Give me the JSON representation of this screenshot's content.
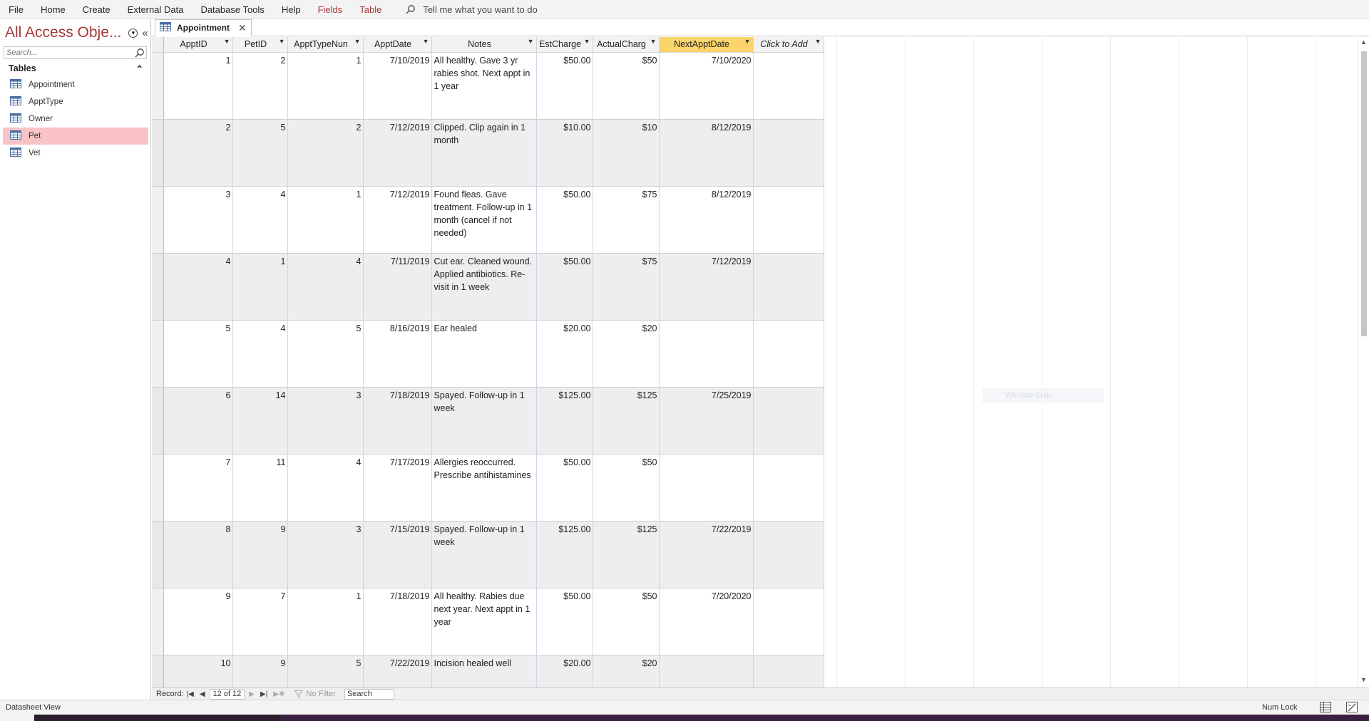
{
  "ribbon": {
    "menus": [
      "File",
      "Home",
      "Create",
      "External Data",
      "Database Tools",
      "Help"
    ],
    "context_menus": [
      "Fields",
      "Table"
    ],
    "tell_me": "Tell me what you want to do"
  },
  "nav": {
    "title": "All Access Obje...",
    "search_placeholder": "Search...",
    "group_label": "Tables",
    "items": [
      "Appointment",
      "ApptType",
      "Owner",
      "Pet",
      "Vet"
    ],
    "selected": "Pet"
  },
  "tab": {
    "label": "Appointment"
  },
  "grid": {
    "columns": [
      "ApptID",
      "PetID",
      "ApptTypeNun",
      "ApptDate",
      "Notes",
      "EstCharge",
      "ActualCharg",
      "NextApptDate",
      "Click to Add"
    ],
    "selected_column": "NextApptDate",
    "rows": [
      [
        "1",
        "2",
        "1",
        "7/10/2019",
        "All healthy. Gave 3 yr rabies shot. Next appt in 1 year",
        "$50.00",
        "$50",
        "7/10/2020"
      ],
      [
        "2",
        "5",
        "2",
        "7/12/2019",
        "Clipped. Clip again in 1 month",
        "$10.00",
        "$10",
        "8/12/2019"
      ],
      [
        "3",
        "4",
        "1",
        "7/12/2019",
        "Found fleas. Gave treatment. Follow-up in 1 month (cancel if not needed)",
        "$50.00",
        "$75",
        "8/12/2019"
      ],
      [
        "4",
        "1",
        "4",
        "7/11/2019",
        "Cut ear. Cleaned wound. Applied antibiotics. Re-visit in 1 week",
        "$50.00",
        "$75",
        "7/12/2019"
      ],
      [
        "5",
        "4",
        "5",
        "8/16/2019",
        "Ear healed",
        "$20.00",
        "$20",
        ""
      ],
      [
        "6",
        "14",
        "3",
        "7/18/2019",
        "Spayed. Follow-up in 1 week",
        "$125.00",
        "$125",
        "7/25/2019"
      ],
      [
        "7",
        "11",
        "4",
        "7/17/2019",
        "Allergies reoccurred. Prescribe antihistamines",
        "$50.00",
        "$50",
        ""
      ],
      [
        "8",
        "9",
        "3",
        "7/15/2019",
        "Spayed. Follow-up in 1 week",
        "$125.00",
        "$125",
        "7/22/2019"
      ],
      [
        "9",
        "7",
        "1",
        "7/18/2019",
        "All healthy. Rabies due next year. Next appt in 1 year",
        "$50.00",
        "$50",
        "7/20/2020"
      ],
      [
        "10",
        "9",
        "5",
        "7/22/2019",
        "Incision healed well",
        "$20.00",
        "$20",
        ""
      ]
    ]
  },
  "record_nav": {
    "label": "Record:",
    "position": "12 of 12",
    "filter": "No Filter",
    "search": "Search"
  },
  "status": {
    "view": "Datasheet View",
    "numlock": "Num Lock"
  },
  "overlay": {
    "snip": "Window Snip"
  },
  "colors": {
    "brand": "#a4373a",
    "selected_nav": "#f9c3c5",
    "selected_col": "#fbd46b"
  }
}
